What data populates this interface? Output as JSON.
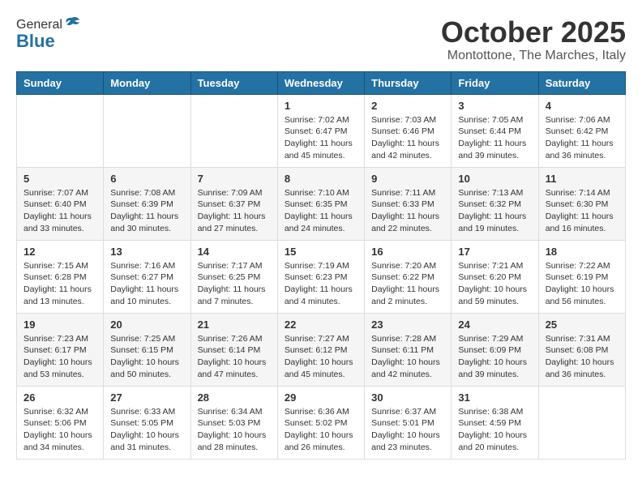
{
  "logo": {
    "general": "General",
    "blue": "Blue"
  },
  "header": {
    "month": "October 2025",
    "location": "Montottone, The Marches, Italy"
  },
  "weekdays": [
    "Sunday",
    "Monday",
    "Tuesday",
    "Wednesday",
    "Thursday",
    "Friday",
    "Saturday"
  ],
  "weeks": [
    [
      {
        "day": "",
        "info": ""
      },
      {
        "day": "",
        "info": ""
      },
      {
        "day": "",
        "info": ""
      },
      {
        "day": "1",
        "info": "Sunrise: 7:02 AM\nSunset: 6:47 PM\nDaylight: 11 hours\nand 45 minutes."
      },
      {
        "day": "2",
        "info": "Sunrise: 7:03 AM\nSunset: 6:46 PM\nDaylight: 11 hours\nand 42 minutes."
      },
      {
        "day": "3",
        "info": "Sunrise: 7:05 AM\nSunset: 6:44 PM\nDaylight: 11 hours\nand 39 minutes."
      },
      {
        "day": "4",
        "info": "Sunrise: 7:06 AM\nSunset: 6:42 PM\nDaylight: 11 hours\nand 36 minutes."
      }
    ],
    [
      {
        "day": "5",
        "info": "Sunrise: 7:07 AM\nSunset: 6:40 PM\nDaylight: 11 hours\nand 33 minutes."
      },
      {
        "day": "6",
        "info": "Sunrise: 7:08 AM\nSunset: 6:39 PM\nDaylight: 11 hours\nand 30 minutes."
      },
      {
        "day": "7",
        "info": "Sunrise: 7:09 AM\nSunset: 6:37 PM\nDaylight: 11 hours\nand 27 minutes."
      },
      {
        "day": "8",
        "info": "Sunrise: 7:10 AM\nSunset: 6:35 PM\nDaylight: 11 hours\nand 24 minutes."
      },
      {
        "day": "9",
        "info": "Sunrise: 7:11 AM\nSunset: 6:33 PM\nDaylight: 11 hours\nand 22 minutes."
      },
      {
        "day": "10",
        "info": "Sunrise: 7:13 AM\nSunset: 6:32 PM\nDaylight: 11 hours\nand 19 minutes."
      },
      {
        "day": "11",
        "info": "Sunrise: 7:14 AM\nSunset: 6:30 PM\nDaylight: 11 hours\nand 16 minutes."
      }
    ],
    [
      {
        "day": "12",
        "info": "Sunrise: 7:15 AM\nSunset: 6:28 PM\nDaylight: 11 hours\nand 13 minutes."
      },
      {
        "day": "13",
        "info": "Sunrise: 7:16 AM\nSunset: 6:27 PM\nDaylight: 11 hours\nand 10 minutes."
      },
      {
        "day": "14",
        "info": "Sunrise: 7:17 AM\nSunset: 6:25 PM\nDaylight: 11 hours\nand 7 minutes."
      },
      {
        "day": "15",
        "info": "Sunrise: 7:19 AM\nSunset: 6:23 PM\nDaylight: 11 hours\nand 4 minutes."
      },
      {
        "day": "16",
        "info": "Sunrise: 7:20 AM\nSunset: 6:22 PM\nDaylight: 11 hours\nand 2 minutes."
      },
      {
        "day": "17",
        "info": "Sunrise: 7:21 AM\nSunset: 6:20 PM\nDaylight: 10 hours\nand 59 minutes."
      },
      {
        "day": "18",
        "info": "Sunrise: 7:22 AM\nSunset: 6:19 PM\nDaylight: 10 hours\nand 56 minutes."
      }
    ],
    [
      {
        "day": "19",
        "info": "Sunrise: 7:23 AM\nSunset: 6:17 PM\nDaylight: 10 hours\nand 53 minutes."
      },
      {
        "day": "20",
        "info": "Sunrise: 7:25 AM\nSunset: 6:15 PM\nDaylight: 10 hours\nand 50 minutes."
      },
      {
        "day": "21",
        "info": "Sunrise: 7:26 AM\nSunset: 6:14 PM\nDaylight: 10 hours\nand 47 minutes."
      },
      {
        "day": "22",
        "info": "Sunrise: 7:27 AM\nSunset: 6:12 PM\nDaylight: 10 hours\nand 45 minutes."
      },
      {
        "day": "23",
        "info": "Sunrise: 7:28 AM\nSunset: 6:11 PM\nDaylight: 10 hours\nand 42 minutes."
      },
      {
        "day": "24",
        "info": "Sunrise: 7:29 AM\nSunset: 6:09 PM\nDaylight: 10 hours\nand 39 minutes."
      },
      {
        "day": "25",
        "info": "Sunrise: 7:31 AM\nSunset: 6:08 PM\nDaylight: 10 hours\nand 36 minutes."
      }
    ],
    [
      {
        "day": "26",
        "info": "Sunrise: 6:32 AM\nSunset: 5:06 PM\nDaylight: 10 hours\nand 34 minutes."
      },
      {
        "day": "27",
        "info": "Sunrise: 6:33 AM\nSunset: 5:05 PM\nDaylight: 10 hours\nand 31 minutes."
      },
      {
        "day": "28",
        "info": "Sunrise: 6:34 AM\nSunset: 5:03 PM\nDaylight: 10 hours\nand 28 minutes."
      },
      {
        "day": "29",
        "info": "Sunrise: 6:36 AM\nSunset: 5:02 PM\nDaylight: 10 hours\nand 26 minutes."
      },
      {
        "day": "30",
        "info": "Sunrise: 6:37 AM\nSunset: 5:01 PM\nDaylight: 10 hours\nand 23 minutes."
      },
      {
        "day": "31",
        "info": "Sunrise: 6:38 AM\nSunset: 4:59 PM\nDaylight: 10 hours\nand 20 minutes."
      },
      {
        "day": "",
        "info": ""
      }
    ]
  ]
}
